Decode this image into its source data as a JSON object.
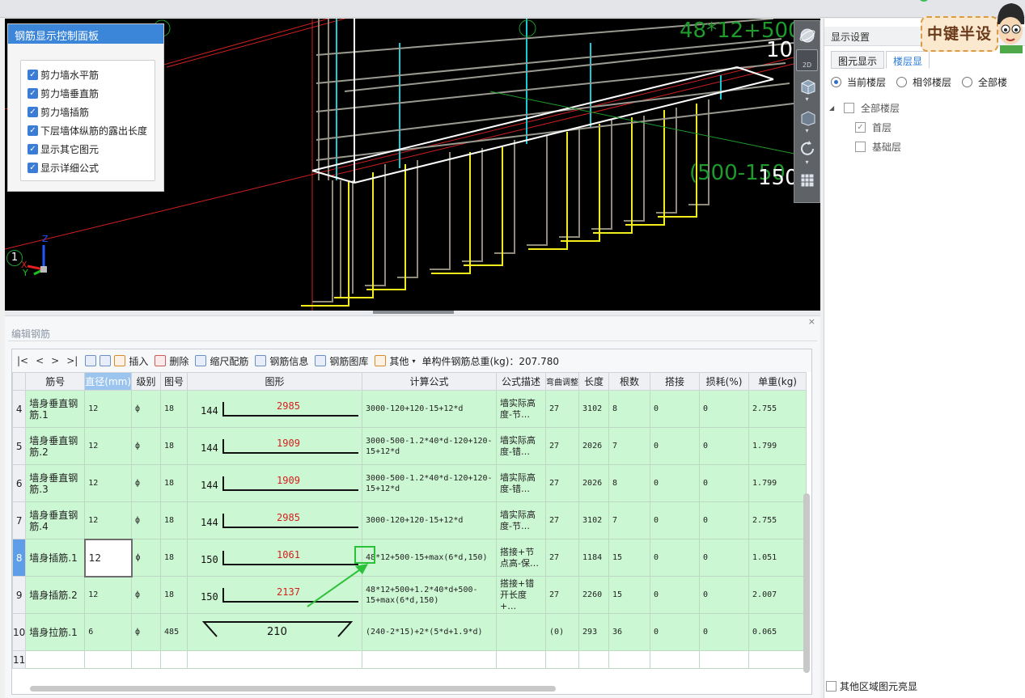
{
  "viewport": {
    "dimension_texts": [
      "48*12+500",
      "10",
      "(500-150",
      "150"
    ],
    "axis": {
      "z": "Z",
      "x": "X",
      "y": "Y",
      "grid_marker": "1"
    }
  },
  "control_panel": {
    "title": "钢筋显示控制面板",
    "options": [
      {
        "label": "剪力墙水平筋",
        "checked": true
      },
      {
        "label": "剪力墙垂直筋",
        "checked": true
      },
      {
        "label": "剪力墙插筋",
        "checked": true
      },
      {
        "label": "下层墙体纵筋的露出长度",
        "checked": true
      },
      {
        "label": "显示其它图元",
        "checked": true
      },
      {
        "label": "显示详细公式",
        "checked": true
      }
    ]
  },
  "vertical_toolbar": {
    "badge_2d": "2D"
  },
  "editor": {
    "close": "×",
    "title": "编辑钢筋",
    "toolbar": {
      "nav": [
        "|<",
        "<",
        ">",
        ">|"
      ],
      "insert": "插入",
      "delete": "删除",
      "scale_rebar": "缩尺配筋",
      "rebar_info": "钢筋信息",
      "rebar_library": "钢筋图库",
      "other": "其他",
      "total_weight": "单构件钢筋总重(kg)：207.780"
    },
    "columns": [
      "筋号",
      "直径(mm)",
      "级别",
      "图号",
      "图形",
      "计算公式",
      "公式描述",
      "弯曲调整",
      "长度",
      "根数",
      "搭接",
      "损耗(%)",
      "单重(kg)"
    ],
    "rows": [
      {
        "no": "4",
        "name": "墙身垂直钢筋.1",
        "dia": "12",
        "grade": "ф",
        "fig": "18",
        "shape_left": "144",
        "shape_top": "2985",
        "formula": "3000-120+120-15+12*d",
        "desc": "墙实际高度-节…",
        "bend": "27",
        "length": "3102",
        "count": "8",
        "lap": "0",
        "loss": "0",
        "weight": "2.755"
      },
      {
        "no": "5",
        "name": "墙身垂直钢筋.2",
        "dia": "12",
        "grade": "ф",
        "fig": "18",
        "shape_left": "144",
        "shape_top": "1909",
        "formula": "3000-500-1.2*40*d-120+120-15+12*d",
        "desc": "墙实际高度-错…",
        "bend": "27",
        "length": "2026",
        "count": "7",
        "lap": "0",
        "loss": "0",
        "weight": "1.799"
      },
      {
        "no": "6",
        "name": "墙身垂直钢筋.3",
        "dia": "12",
        "grade": "ф",
        "fig": "18",
        "shape_left": "144",
        "shape_top": "1909",
        "formula": "3000-500-1.2*40*d-120+120-15+12*d",
        "desc": "墙实际高度-错…",
        "bend": "27",
        "length": "2026",
        "count": "8",
        "lap": "0",
        "loss": "0",
        "weight": "1.799"
      },
      {
        "no": "7",
        "name": "墙身垂直钢筋.4",
        "dia": "12",
        "grade": "ф",
        "fig": "18",
        "shape_left": "144",
        "shape_top": "2985",
        "formula": "3000-120+120-15+12*d",
        "desc": "墙实际高度-节…",
        "bend": "27",
        "length": "3102",
        "count": "7",
        "lap": "0",
        "loss": "0",
        "weight": "2.755"
      },
      {
        "no": "8",
        "name": "墙身插筋.1",
        "dia": "12",
        "grade": "ф",
        "fig": "18",
        "shape_left": "150",
        "shape_top": "1061",
        "formula": "48*12+500-15+max(6*d,150)",
        "desc": "搭接+节点高-保…",
        "bend": "27",
        "length": "1184",
        "count": "15",
        "lap": "0",
        "loss": "0",
        "weight": "1.051"
      },
      {
        "no": "9",
        "name": "墙身插筋.2",
        "dia": "12",
        "grade": "ф",
        "fig": "18",
        "shape_left": "150",
        "shape_top": "2137",
        "formula": "48*12+500+1.2*40*d+500-15+max(6*d,150)",
        "desc": "搭接+错开长度+…",
        "bend": "27",
        "length": "2260",
        "count": "15",
        "lap": "0",
        "loss": "0",
        "weight": "2.007"
      },
      {
        "no": "10",
        "name": "墙身拉筋.1",
        "dia": "6",
        "grade": "ф",
        "fig": "485",
        "shape_center": "210",
        "formula": "(240-2*15)+2*(5*d+1.9*d)",
        "desc": "",
        "bend": "(0)",
        "length": "293",
        "count": "36",
        "lap": "0",
        "loss": "0",
        "weight": "0.065"
      }
    ],
    "empty_row_no": "11"
  },
  "right_panel": {
    "title": "显示设置",
    "tabs": [
      "图元显示",
      "楼层显"
    ],
    "radios": [
      {
        "label": "当前楼层",
        "selected": true
      },
      {
        "label": "相邻楼层",
        "selected": false
      },
      {
        "label": "全部楼",
        "selected": false
      }
    ],
    "tree": {
      "root": "全部楼层",
      "children": [
        {
          "label": "首层",
          "checked": true
        },
        {
          "label": "基础层",
          "checked": false
        }
      ]
    },
    "bottom_checkbox": "其他区域图元亮显"
  },
  "logo_text": "中键半设",
  "colors": {
    "accent": "#3b86d8",
    "row_green": "#ccf7d3",
    "annotation": "#2bc23a",
    "dim_green": "#1f9b2c",
    "rebar_yellow": "#f4ec1a",
    "rebar_cyan": "#18c9d6"
  }
}
